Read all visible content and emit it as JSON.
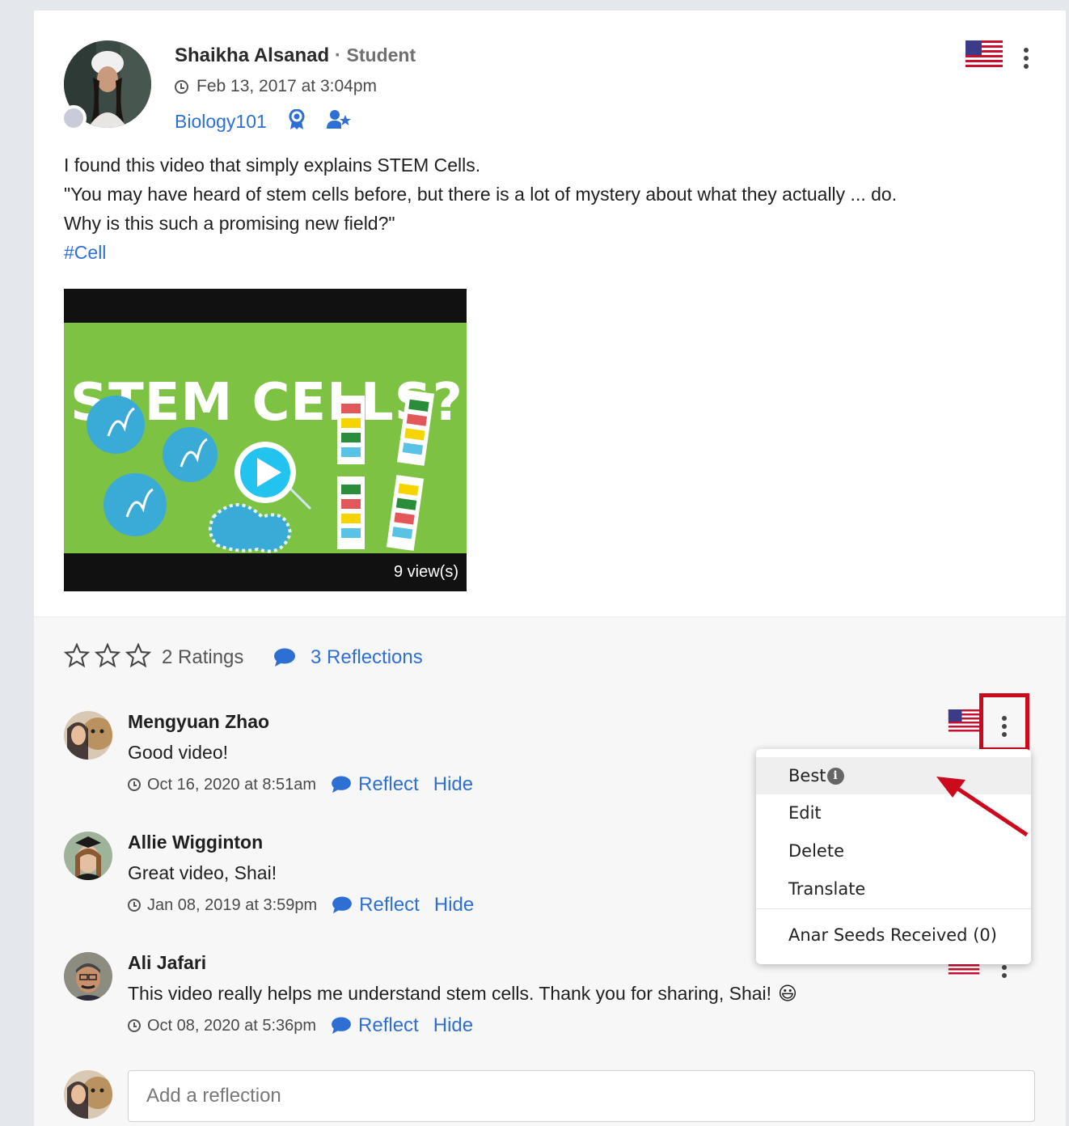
{
  "post": {
    "author": "Shaikha Alsanad",
    "separator": " · ",
    "role": "Student",
    "timestamp": "Feb 13, 2017 at 3:04pm",
    "course": "Biology101",
    "body_lines": [
      "I found this video that simply explains STEM Cells.",
      "\"You may have heard of stem cells before, but there is a lot of mystery about what they actually ... do.",
      "Why is this such a promising new field?\""
    ],
    "hashtag": "#Cell",
    "video": {
      "title": "STEM CELLS?",
      "views": "9 view(s)"
    }
  },
  "footer": {
    "ratings_label": "2 Ratings",
    "reflections_label": "3 Reflections"
  },
  "comments": [
    {
      "name": "Mengyuan Zhao",
      "text": "Good video!",
      "timestamp": "Oct 16, 2020 at 8:51am",
      "reflect": "Reflect",
      "hide": "Hide"
    },
    {
      "name": "Allie Wigginton",
      "text": "Great video, Shai!",
      "timestamp": "Jan 08, 2019 at 3:59pm",
      "reflect": "Reflect",
      "hide": "Hide"
    },
    {
      "name": "Ali Jafari",
      "text": "This video really helps me understand stem cells. Thank you for sharing, Shai!",
      "emoji": "😃",
      "timestamp": "Oct 08, 2020 at 5:36pm",
      "reflect": "Reflect",
      "hide": "Hide"
    }
  ],
  "add_reflection": {
    "placeholder": "Add a reflection"
  },
  "menu": {
    "items": [
      "Best",
      "Edit",
      "Delete",
      "Translate"
    ],
    "seeds": "Anar Seeds Received (0)"
  },
  "colors": {
    "link": "#2e6fd4",
    "highlight": "#cc0a1e",
    "video_green": "#7dc242"
  }
}
